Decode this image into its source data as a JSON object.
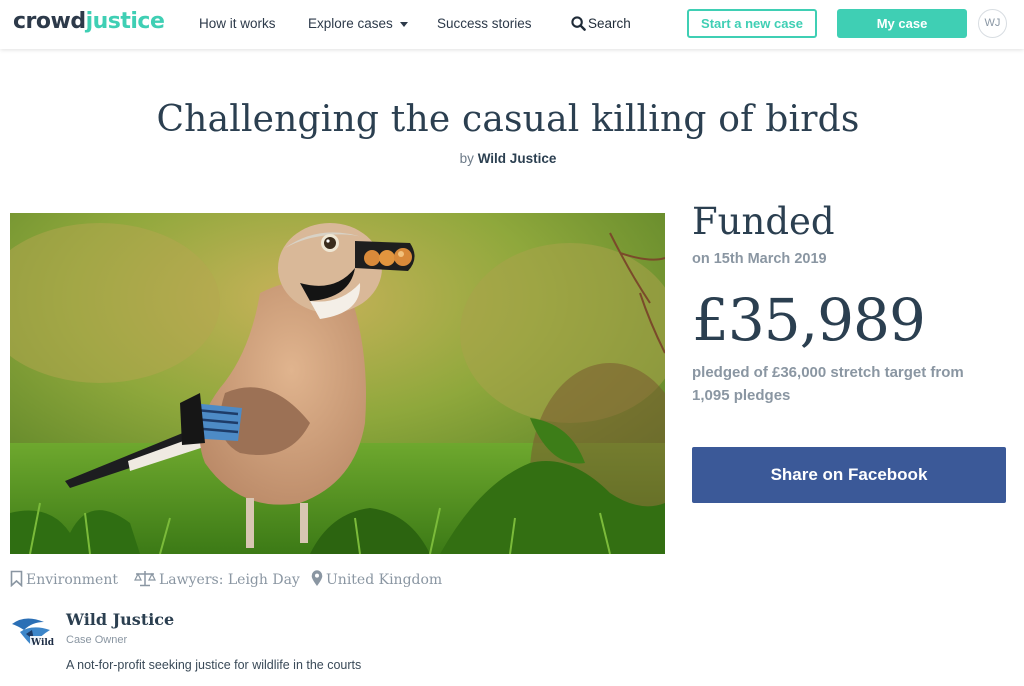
{
  "nav": {
    "logo_part1": "crowd",
    "logo_part2": "justice",
    "how_it_works": "How it works",
    "explore_cases": "Explore cases",
    "success_stories": "Success stories",
    "search": "Search",
    "start_case": "Start a new case",
    "my_case": "My case",
    "avatar_initials": "WJ"
  },
  "case": {
    "title": "Challenging the casual killing of birds",
    "by_prefix": "by",
    "author": "Wild Justice",
    "status": "Funded",
    "funded_date": "on 15th March 2019",
    "amount": "£35,989",
    "pledged_text": "pledged of £36,000 stretch target from 1,095 pledges",
    "share_button": "Share on Facebook",
    "image_alt": "Jay bird holding nuts in its beak on grass"
  },
  "meta": {
    "category": "Environment",
    "lawyers": "Lawyers: Leigh Day",
    "location": "United Kingdom"
  },
  "owner": {
    "name": "Wild Justice",
    "role": "Case Owner",
    "description": "A not-for-profit seeking justice for wildlife in the courts",
    "logo_text": "Wild"
  },
  "colors": {
    "accent": "#3fcfb4",
    "facebook": "#3b5998",
    "heading": "#2b3f50",
    "muted": "#8a96a2"
  },
  "icons": [
    "search-icon",
    "caret-down-icon",
    "bookmark-icon",
    "scales-icon",
    "location-pin-icon"
  ]
}
